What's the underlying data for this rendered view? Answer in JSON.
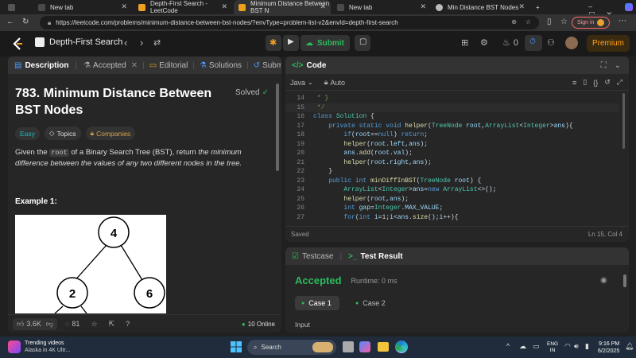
{
  "browser": {
    "tabs": [
      {
        "title": "New tab"
      },
      {
        "title": "Depth-First Search - LeetCode"
      },
      {
        "title": "Minimum Distance Between BST N"
      },
      {
        "title": "New tab"
      },
      {
        "title": "Min Distance BST Nodes"
      }
    ],
    "url": "https://leetcode.com/problems/minimum-distance-between-bst-nodes/?envType=problem-list-v2&envId=depth-first-search",
    "signin": "Sign in"
  },
  "header": {
    "list_title": "Depth-First Search",
    "submit": "Submit",
    "streak": "0",
    "premium": "Premium"
  },
  "left": {
    "tabs": {
      "description": "Description",
      "accepted": "Accepted",
      "editorial": "Editorial",
      "solutions": "Solutions",
      "submissions": "Submissions"
    },
    "title": "783. Minimum Distance Between BST Nodes",
    "solved": "Solved",
    "tags": {
      "easy": "Easy",
      "topics": "Topics",
      "companies": "Companies"
    },
    "desc": {
      "p1": "Given the ",
      "code": "root",
      "p2": " of a Binary Search Tree (BST), return ",
      "em": "the minimum difference between the values of any two different nodes in the tree."
    },
    "example": "Example 1:",
    "tree": {
      "root": "4",
      "left": "2",
      "right": "6"
    },
    "footer": {
      "likes": "3.6K",
      "comments": "81",
      "online": "10 Online"
    }
  },
  "editor": {
    "title": "Code",
    "lang": "Java",
    "auto": "Auto",
    "lines": [
      {
        "n": "14",
        "t": " * }"
      },
      {
        "n": "15",
        "t": " */"
      },
      {
        "n": "16",
        "t": "class Solution {"
      },
      {
        "n": "17",
        "t": "    private static void helper(TreeNode root,ArrayList<Integer>ans){"
      },
      {
        "n": "18",
        "t": "        if(root==null) return;"
      },
      {
        "n": "19",
        "t": "        helper(root.left,ans);"
      },
      {
        "n": "20",
        "t": "        ans.add(root.val);"
      },
      {
        "n": "21",
        "t": "        helper(root.right,ans);"
      },
      {
        "n": "22",
        "t": "    }"
      },
      {
        "n": "23",
        "t": "    public int minDiffInBST(TreeNode root) {"
      },
      {
        "n": "24",
        "t": "        ArrayList<Integer>ans=new ArrayList<>();"
      },
      {
        "n": "25",
        "t": "        helper(root,ans);"
      },
      {
        "n": "26",
        "t": "        int gap=Integer.MAX_VALUE;"
      },
      {
        "n": "27",
        "t": "        for(int i=1;i<ans.size();i++){"
      }
    ],
    "saved": "Saved",
    "position": "Ln 15, Col 4"
  },
  "result": {
    "tab_testcase": "Testcase",
    "tab_result": "Test Result",
    "status": "Accepted",
    "runtime": "Runtime: 0 ms",
    "case1": "Case 1",
    "case2": "Case 2",
    "input": "Input"
  },
  "taskbar": {
    "news_title": "Trending videos",
    "news_sub": "Alaska in 4K Ultr...",
    "search": "Search",
    "lang1": "ENG",
    "lang2": "IN",
    "time": "9:16 PM",
    "date": "6/2/2025"
  },
  "colors": {
    "accent_green": "#2cbb5d",
    "easy": "#1cb8b8",
    "premium": "#ffa116"
  }
}
